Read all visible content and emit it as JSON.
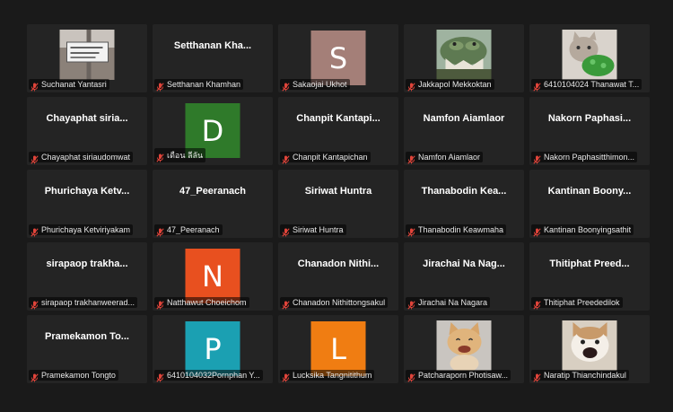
{
  "participants": [
    {
      "display": "photo",
      "photo_icon": "street-sign-photo-icon",
      "label": "Suchanat Yantasri"
    },
    {
      "display": "name",
      "big": "Setthanan  Kha...",
      "label": "Setthanan Khamhan"
    },
    {
      "display": "avatar",
      "letter": "S",
      "color": "#a47f78",
      "label": "Sakaojai Ukhot"
    },
    {
      "display": "photo",
      "photo_icon": "crocodile-photo-icon",
      "label": "Jakkapol Mekkoktan"
    },
    {
      "display": "photo",
      "photo_icon": "cat-green-toy-photo-icon",
      "label": "6410104024 Thanawat T..."
    },
    {
      "display": "name",
      "big": "Chayaphat  siria...",
      "label": "Chayaphat siriaudomwat"
    },
    {
      "display": "avatar",
      "letter": "D",
      "color": "#2f7a2a",
      "label": "เดือน ลีลัน"
    },
    {
      "display": "name",
      "big": "Chanpit  Kantapi...",
      "label": "Chanpit Kantapichan"
    },
    {
      "display": "name",
      "big": "Namfon Aiamlaor",
      "label": "Namfon Aiamlaor"
    },
    {
      "display": "name",
      "big": "Nakorn  Paphasi...",
      "label": "Nakorn Paphasitthimon..."
    },
    {
      "display": "name",
      "big": "Phurichaya  Ketv...",
      "label": "Phurichaya Ketviriyakam"
    },
    {
      "display": "name",
      "big": "47_Peeranach",
      "label": "47_Peeranach"
    },
    {
      "display": "name",
      "big": "Siriwat Huntra",
      "label": "Siriwat Huntra"
    },
    {
      "display": "name",
      "big": "Thanabodin  Kea...",
      "label": "Thanabodin Keawmaha"
    },
    {
      "display": "name",
      "big": "Kantinan  Boony...",
      "label": "Kantinan Boonyingsathit"
    },
    {
      "display": "name",
      "big": "sirapaop  trakha...",
      "label": "sirapaop trakhanweerad..."
    },
    {
      "display": "avatar",
      "letter": "N",
      "color": "#e8501f",
      "label": "Natthawut Choeichom"
    },
    {
      "display": "name",
      "big": "Chanadon  Nithi...",
      "label": "Chanadon Nithittongsakul"
    },
    {
      "display": "name",
      "big": "Jirachai  Na  Nag...",
      "label": "Jirachai Na Nagara"
    },
    {
      "display": "name",
      "big": "Thitiphat  Preed...",
      "label": "Thitiphat Preededilok"
    },
    {
      "display": "name",
      "big": "Pramekamon  To...",
      "label": "Pramekamon Tongto"
    },
    {
      "display": "avatar",
      "letter": "P",
      "color": "#1ba0b2",
      "label": "6410104032Pornphan Y..."
    },
    {
      "display": "avatar",
      "letter": "L",
      "color": "#f07d12",
      "label": "Lucksika Tangnitithum"
    },
    {
      "display": "photo",
      "photo_icon": "smiling-cat-photo-icon",
      "label": "Patcharaporn  Photisaw..."
    },
    {
      "display": "photo",
      "photo_icon": "pop-cat-photo-icon",
      "label": "Naratip Thianchindakul"
    }
  ],
  "colors": {
    "tile_bg": "#242424",
    "mic_muted": "#e0443a"
  }
}
